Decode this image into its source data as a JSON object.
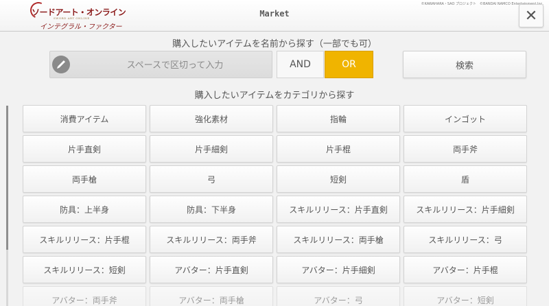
{
  "header": {
    "title": "Market",
    "logo_main": "ソードアート・オンライン",
    "logo_sub": "SWORD ART ONLINE",
    "logo_script": "インテグラル・ファクター",
    "copyright": "©KAWAHARA・SAO プロジェクト　©BANDAI NAMCO Entertainment Inc.",
    "close_glyph": "✕"
  },
  "name_search": {
    "label": "購入したいアイテムを名前から探す（一部でも可）",
    "placeholder": "スペースで区切って入力",
    "and_label": "AND",
    "or_label": "OR",
    "selected_mode": "OR",
    "search_label": "検索",
    "pencil_icon": "pencil-icon"
  },
  "category_search": {
    "label": "購入したいアイテムをカテゴリから探す",
    "items": [
      "消費アイテム",
      "強化素材",
      "指輪",
      "インゴット",
      "片手直剣",
      "片手細剣",
      "片手棍",
      "両手斧",
      "両手槍",
      "弓",
      "短剣",
      "盾",
      "防具：上半身",
      "防具：下半身",
      "スキルリリース：片手直剣",
      "スキルリリース：片手細剣",
      "スキルリリース：片手棍",
      "スキルリリース：両手斧",
      "スキルリリース：両手槍",
      "スキルリリース：弓",
      "スキルリリース：短剣",
      "アバター：片手直剣",
      "アバター：片手細剣",
      "アバター：片手棍",
      "アバター：両手斧",
      "アバター：両手槍",
      "アバター：弓",
      "アバター：短剣"
    ],
    "visible_partial_from": 24
  },
  "colors": {
    "accent": "#f0b400",
    "background": "#f2f2f2",
    "logo_red": "#8b1b1b"
  }
}
